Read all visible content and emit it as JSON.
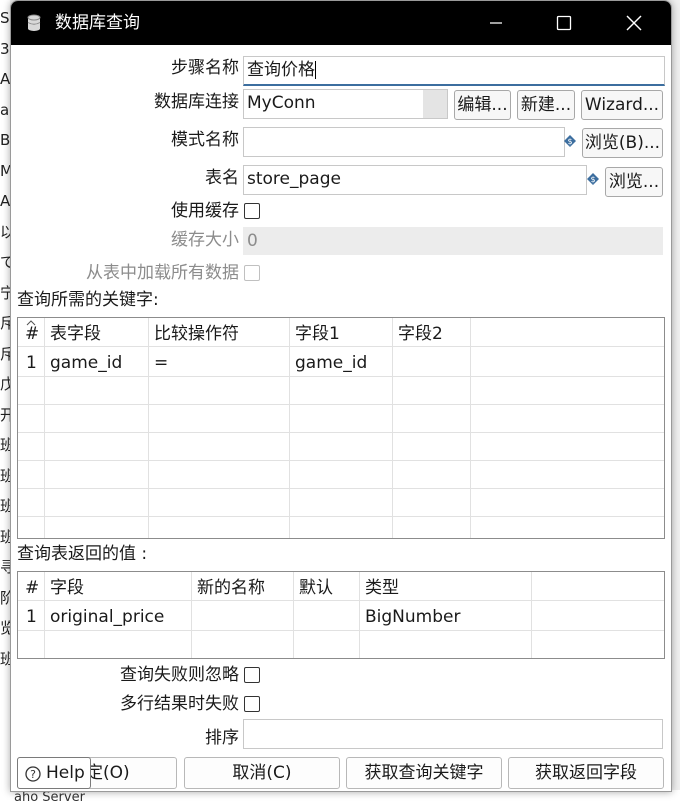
{
  "background": {
    "left_chars": [
      "S",
      "3",
      "A",
      "al",
      "B",
      "M",
      "A",
      "以",
      "で",
      "宁",
      "斥",
      "斥",
      "戊",
      "开",
      "班",
      "班",
      "班",
      "班",
      "寻",
      "阶",
      "览",
      "班"
    ],
    "bottom_text": "aho Server"
  },
  "window": {
    "title": "数据库查询",
    "icon": "database-icon"
  },
  "form": {
    "step_name": {
      "label": "步骤名称",
      "value": "查询价格"
    },
    "db_connection": {
      "label": "数据库连接",
      "value": "MyConn",
      "edit_label": "编辑...",
      "new_label": "新建...",
      "wizard_label": "Wizard..."
    },
    "schema": {
      "label": "模式名称",
      "value": "",
      "browse_label": "浏览(B)..."
    },
    "table": {
      "label": "表名",
      "value": "store_page",
      "browse_label": "浏览..."
    },
    "use_cache": {
      "label": "使用缓存",
      "checked": false
    },
    "cache_size": {
      "label": "缓存大小",
      "value": "0"
    },
    "load_all": {
      "label": "从表中加载所有数据",
      "checked": false
    }
  },
  "keys_section": {
    "title": "查询所需的关键字:",
    "headers": [
      "#",
      "表字段",
      "比较操作符",
      "字段1",
      "字段2"
    ],
    "rows": [
      [
        "1",
        "game_id",
        "=",
        "game_id",
        ""
      ]
    ]
  },
  "return_section": {
    "title": "查询表返回的值 :",
    "headers": [
      "#",
      "字段",
      "新的名称",
      "默认",
      "类型"
    ],
    "rows": [
      [
        "1",
        "original_price",
        "",
        "",
        "BigNumber"
      ]
    ]
  },
  "options": {
    "ignore_fail": {
      "label": "查询失败则忽略",
      "checked": false
    },
    "fail_multi": {
      "label": "多行结果时失败",
      "checked": false
    },
    "order_by": {
      "label": "排序",
      "value": ""
    }
  },
  "buttons": {
    "help": "Help",
    "ok": "确定(O)",
    "ok_visible": "定(O)",
    "cancel": "取消(C)",
    "get_keys": "获取查询关键字",
    "get_fields": "获取返回字段"
  },
  "colors": {
    "titlebar": "#000000",
    "accent": "#3c6e9f"
  }
}
